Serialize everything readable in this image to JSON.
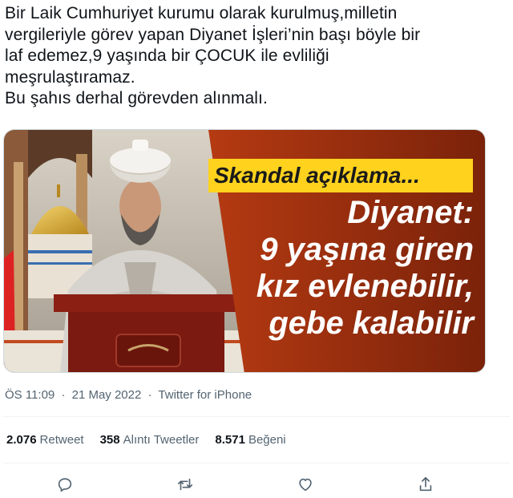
{
  "tweet": {
    "lines": [
      "Bir Laik Cumhuriyet kurumu olarak kurulmuş,milletin",
      "vergileriyle görev yapan Diyanet İşleri’nin başı böyle bir",
      "laf edemez,9 yaşında bir ÇOCUK ile evliliği",
      "meşrulaştıramaz.",
      "Bu şahıs derhal görevden alınmalı."
    ]
  },
  "media": {
    "banner": "Skandal açıklama...",
    "headline": [
      "Diyanet:",
      "9 yaşına giren",
      "kız evlenebilir,",
      "gebe kalabilir"
    ],
    "colors": {
      "panel": "#9a2f10",
      "panel_light": "#c8481a",
      "banner": "#ffd21e"
    }
  },
  "meta": {
    "time": "ÖS 11:09",
    "sep1": "·",
    "date": "21 May 2022",
    "sep2": "·",
    "source": "Twitter for iPhone"
  },
  "stats": {
    "retweets": {
      "count": "2.076",
      "label": "Retweet"
    },
    "quotes": {
      "count": "358",
      "label": "Alıntı Tweetler"
    },
    "likes": {
      "count": "8.571",
      "label": "Beğeni"
    }
  },
  "actions": [
    "reply-icon",
    "retweet-icon",
    "like-icon",
    "share-icon"
  ]
}
